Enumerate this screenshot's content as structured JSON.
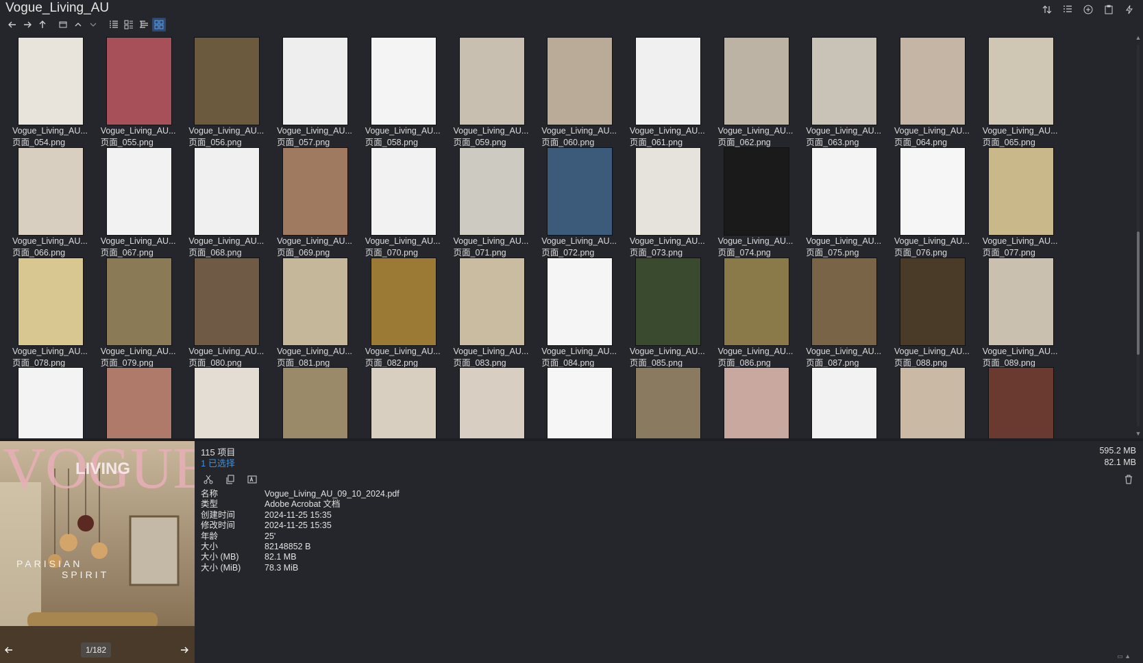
{
  "window": {
    "title": "Vogue_Living_AU"
  },
  "nav": {
    "back_icon": "arrow-left-icon",
    "forward_icon": "arrow-right-icon",
    "up_icon": "arrow-up-icon"
  },
  "files": [
    {
      "name": "Vogue_Living_AU...",
      "sub": "页面_054.png"
    },
    {
      "name": "Vogue_Living_AU...",
      "sub": "页面_055.png"
    },
    {
      "name": "Vogue_Living_AU...",
      "sub": "页面_056.png"
    },
    {
      "name": "Vogue_Living_AU...",
      "sub": "页面_057.png"
    },
    {
      "name": "Vogue_Living_AU...",
      "sub": "页面_058.png"
    },
    {
      "name": "Vogue_Living_AU...",
      "sub": "页面_059.png"
    },
    {
      "name": "Vogue_Living_AU...",
      "sub": "页面_060.png"
    },
    {
      "name": "Vogue_Living_AU...",
      "sub": "页面_061.png"
    },
    {
      "name": "Vogue_Living_AU...",
      "sub": "页面_062.png"
    },
    {
      "name": "Vogue_Living_AU...",
      "sub": "页面_063.png"
    },
    {
      "name": "Vogue_Living_AU...",
      "sub": "页面_064.png"
    },
    {
      "name": "Vogue_Living_AU...",
      "sub": "页面_065.png"
    },
    {
      "name": "Vogue_Living_AU...",
      "sub": "页面_066.png"
    },
    {
      "name": "Vogue_Living_AU...",
      "sub": "页面_067.png"
    },
    {
      "name": "Vogue_Living_AU...",
      "sub": "页面_068.png"
    },
    {
      "name": "Vogue_Living_AU...",
      "sub": "页面_069.png"
    },
    {
      "name": "Vogue_Living_AU...",
      "sub": "页面_070.png"
    },
    {
      "name": "Vogue_Living_AU...",
      "sub": "页面_071.png"
    },
    {
      "name": "Vogue_Living_AU...",
      "sub": "页面_072.png"
    },
    {
      "name": "Vogue_Living_AU...",
      "sub": "页面_073.png"
    },
    {
      "name": "Vogue_Living_AU...",
      "sub": "页面_074.png"
    },
    {
      "name": "Vogue_Living_AU...",
      "sub": "页面_075.png"
    },
    {
      "name": "Vogue_Living_AU...",
      "sub": "页面_076.png"
    },
    {
      "name": "Vogue_Living_AU...",
      "sub": "页面_077.png"
    },
    {
      "name": "Vogue_Living_AU...",
      "sub": "页面_078.png"
    },
    {
      "name": "Vogue_Living_AU...",
      "sub": "页面_079.png"
    },
    {
      "name": "Vogue_Living_AU...",
      "sub": "页面_080.png"
    },
    {
      "name": "Vogue_Living_AU...",
      "sub": "页面_081.png"
    },
    {
      "name": "Vogue_Living_AU...",
      "sub": "页面_082.png"
    },
    {
      "name": "Vogue_Living_AU...",
      "sub": "页面_083.png"
    },
    {
      "name": "Vogue_Living_AU...",
      "sub": "页面_084.png"
    },
    {
      "name": "Vogue_Living_AU...",
      "sub": "页面_085.png"
    },
    {
      "name": "Vogue_Living_AU...",
      "sub": "页面_086.png"
    },
    {
      "name": "Vogue_Living_AU...",
      "sub": "页面_087.png"
    },
    {
      "name": "Vogue_Living_AU...",
      "sub": "页面_088.png"
    },
    {
      "name": "Vogue_Living_AU...",
      "sub": "页面_089.png"
    },
    {
      "name": "",
      "sub": ""
    },
    {
      "name": "",
      "sub": ""
    },
    {
      "name": "",
      "sub": ""
    },
    {
      "name": "",
      "sub": ""
    },
    {
      "name": "",
      "sub": ""
    },
    {
      "name": "",
      "sub": ""
    },
    {
      "name": "",
      "sub": ""
    },
    {
      "name": "",
      "sub": ""
    },
    {
      "name": "",
      "sub": ""
    },
    {
      "name": "",
      "sub": ""
    },
    {
      "name": "",
      "sub": ""
    },
    {
      "name": "",
      "sub": ""
    }
  ],
  "thumb_colors": [
    "#e8e4dc",
    "#a8505a",
    "#6b5a3e",
    "#eeeeee",
    "#f4f4f4",
    "#c9bfb0",
    "#b9ab98",
    "#f0f0f0",
    "#bdb3a4",
    "#c9c2b7",
    "#c5b5a5",
    "#cfc6b4",
    "#d9cfc0",
    "#f2f2f2",
    "#f0f0f0",
    "#a07a60",
    "#f2f2f2",
    "#cdcac2",
    "#3c5a7a",
    "#e6e2dc",
    "#1a1a1a",
    "#f4f4f4",
    "#f6f6f6",
    "#c9b98a",
    "#d8c790",
    "#8a7a55",
    "#6e5a45",
    "#c5b79a",
    "#9a7a35",
    "#c9bca0",
    "#f5f5f5",
    "#3a4a2e",
    "#8a7a4a",
    "#7a6448",
    "#4a3a28",
    "#c9c0b0",
    "#f3f3f3",
    "#b07a6a",
    "#e4ddd4",
    "#9a8a6a",
    "#d8cfc0",
    "#d8cfc2",
    "#f6f6f6",
    "#8a7a60",
    "#c9a8a0",
    "#f2f2f2",
    "#c9b9a5",
    "#6a3a30"
  ],
  "status": {
    "count": "115 项目",
    "selected": "1 已选择",
    "total_size": "595.2 MB",
    "selected_size": "82.1 MB"
  },
  "preview": {
    "counter": "1/182",
    "cover_masthead": "VOGUE",
    "cover_sub": "LIVING",
    "cover_line1": "PARISIAN",
    "cover_line2": "SPIRIT"
  },
  "properties": [
    {
      "key": "名称",
      "value": "Vogue_Living_AU_09_10_2024.pdf"
    },
    {
      "key": "类型",
      "value": "Adobe Acrobat 文档"
    },
    {
      "key": "创建时间",
      "value": "2024-11-25  15:35"
    },
    {
      "key": "修改时间",
      "value": "2024-11-25  15:35"
    },
    {
      "key": "年龄",
      "value": "25'"
    },
    {
      "key": "大小",
      "value": "82148852 B"
    },
    {
      "key": "大小 (MB)",
      "value": "82.1 MB"
    },
    {
      "key": "大小 (MiB)",
      "value": "78.3 MiB"
    }
  ]
}
